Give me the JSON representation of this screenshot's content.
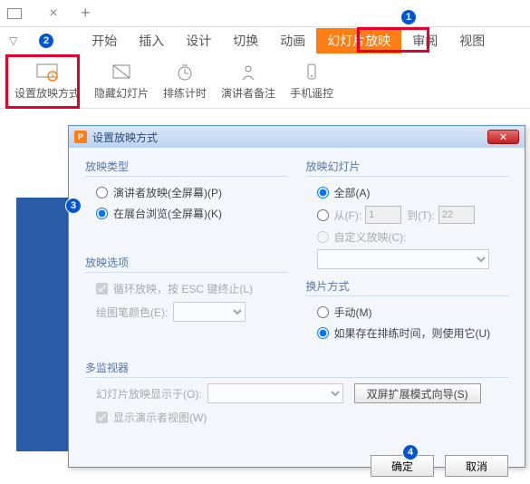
{
  "ribbon_tabs": {
    "start": "开始",
    "insert": "插入",
    "design": "设计",
    "transition": "切换",
    "animation": "动画",
    "slideshow": "幻灯片放映",
    "review": "审阅",
    "view": "视图"
  },
  "ribbon_buttons": {
    "setup_show": "设置放映方式",
    "hide_slide": "隐藏幻灯片",
    "rehearse": "排练计时",
    "presenter_notes": "演讲者备注",
    "phone_remote": "手机遥控"
  },
  "annotations": {
    "n1": "1",
    "n2": "2",
    "n3": "3",
    "n4": "4"
  },
  "dialog": {
    "title": "设置放映方式",
    "close_icon": "✕",
    "group_type": "放映类型",
    "type_presenter": "演讲者放映(全屏幕)(P)",
    "type_kiosk": "在展台浏览(全屏幕)(K)",
    "group_options": "放映选项",
    "opt_loop": "循环放映，按 ESC 键终止(L)",
    "opt_pen_color": "绘图笔颜色(E):",
    "group_slides": "放映幻灯片",
    "slides_all": "全部(A)",
    "slides_from_label": "从(F):",
    "slides_from_val": "1",
    "slides_to_label": "到(T):",
    "slides_to_val": "22",
    "slides_custom": "自定义放映(C):",
    "group_advance": "换片方式",
    "advance_manual": "手动(M)",
    "advance_timing": "如果存在排练时间，则使用它(U)",
    "group_multi": "多监视器",
    "multi_display_label": "幻灯片放映显示于(O):",
    "multi_dual_btn": "双屏扩展模式向导(S)",
    "multi_show_presenter": "显示演示者视图(W)",
    "ok": "确定",
    "cancel": "取消"
  }
}
